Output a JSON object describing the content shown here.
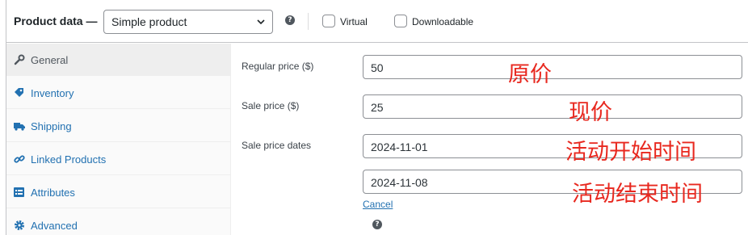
{
  "header": {
    "title": "Product data —",
    "product_type": "Simple product",
    "help_icon": "help-icon",
    "virtual_label": "Virtual",
    "virtual_checked": false,
    "downloadable_label": "Downloadable",
    "downloadable_checked": false
  },
  "tabs": [
    {
      "label": "General",
      "icon": "wrench-icon",
      "active": true
    },
    {
      "label": "Inventory",
      "icon": "tag-icon",
      "active": false
    },
    {
      "label": "Shipping",
      "icon": "truck-icon",
      "active": false
    },
    {
      "label": "Linked Products",
      "icon": "link-icon",
      "active": false
    },
    {
      "label": "Attributes",
      "icon": "list-icon",
      "active": false
    },
    {
      "label": "Advanced",
      "icon": "gear-icon",
      "active": false
    }
  ],
  "general": {
    "regular_price_label": "Regular price ($)",
    "regular_price_value": "50",
    "sale_price_label": "Sale price ($)",
    "sale_price_value": "25",
    "sale_dates_label": "Sale price dates",
    "sale_date_from": "2024-11-01",
    "sale_date_to": "2024-11-08",
    "cancel_label": "Cancel"
  },
  "annotations": {
    "regular_price": "原价",
    "sale_price": "现价",
    "start_date": "活动开始时间",
    "end_date": "活动结束时间"
  },
  "colors": {
    "link": "#2271b1",
    "annotation": "#e8281f",
    "border": "#8c8f94"
  }
}
